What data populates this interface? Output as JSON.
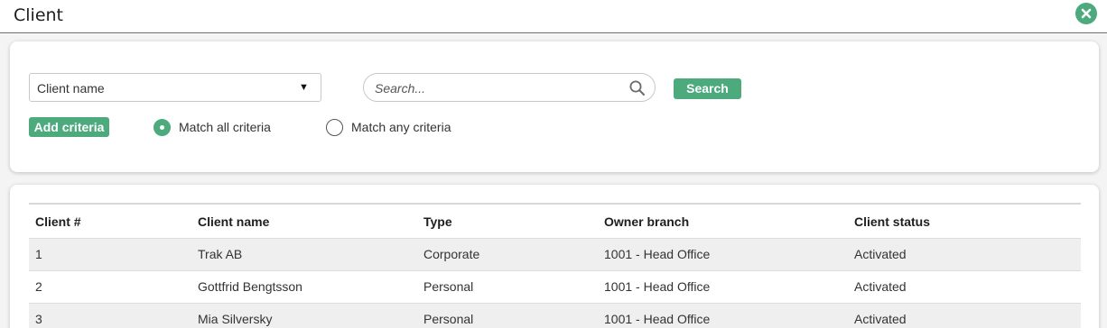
{
  "window": {
    "title": "Client"
  },
  "filter": {
    "field_select": {
      "selected": "Client name",
      "arrow": "▼"
    },
    "search": {
      "placeholder": "Search...",
      "value": "",
      "icon": "magnifier-icon"
    },
    "search_button": "Search",
    "add_criteria_button": "Add criteria",
    "match_options": [
      {
        "label": "Match all criteria",
        "checked": true
      },
      {
        "label": "Match any criteria",
        "checked": false
      }
    ]
  },
  "table": {
    "columns": [
      "Client #",
      "Client name",
      "Type",
      "Owner branch",
      "Client status"
    ],
    "rows": [
      [
        "1",
        "Trak AB",
        "Corporate",
        "1001 - Head Office",
        "Activated"
      ],
      [
        "2",
        "Gottfrid Bengtsson",
        "Personal",
        "1001 - Head Office",
        "Activated"
      ],
      [
        "3",
        "Mia Silversky",
        "Personal",
        "1001 - Head Office",
        "Activated"
      ]
    ]
  },
  "colors": {
    "accent": "#4caa7d"
  }
}
